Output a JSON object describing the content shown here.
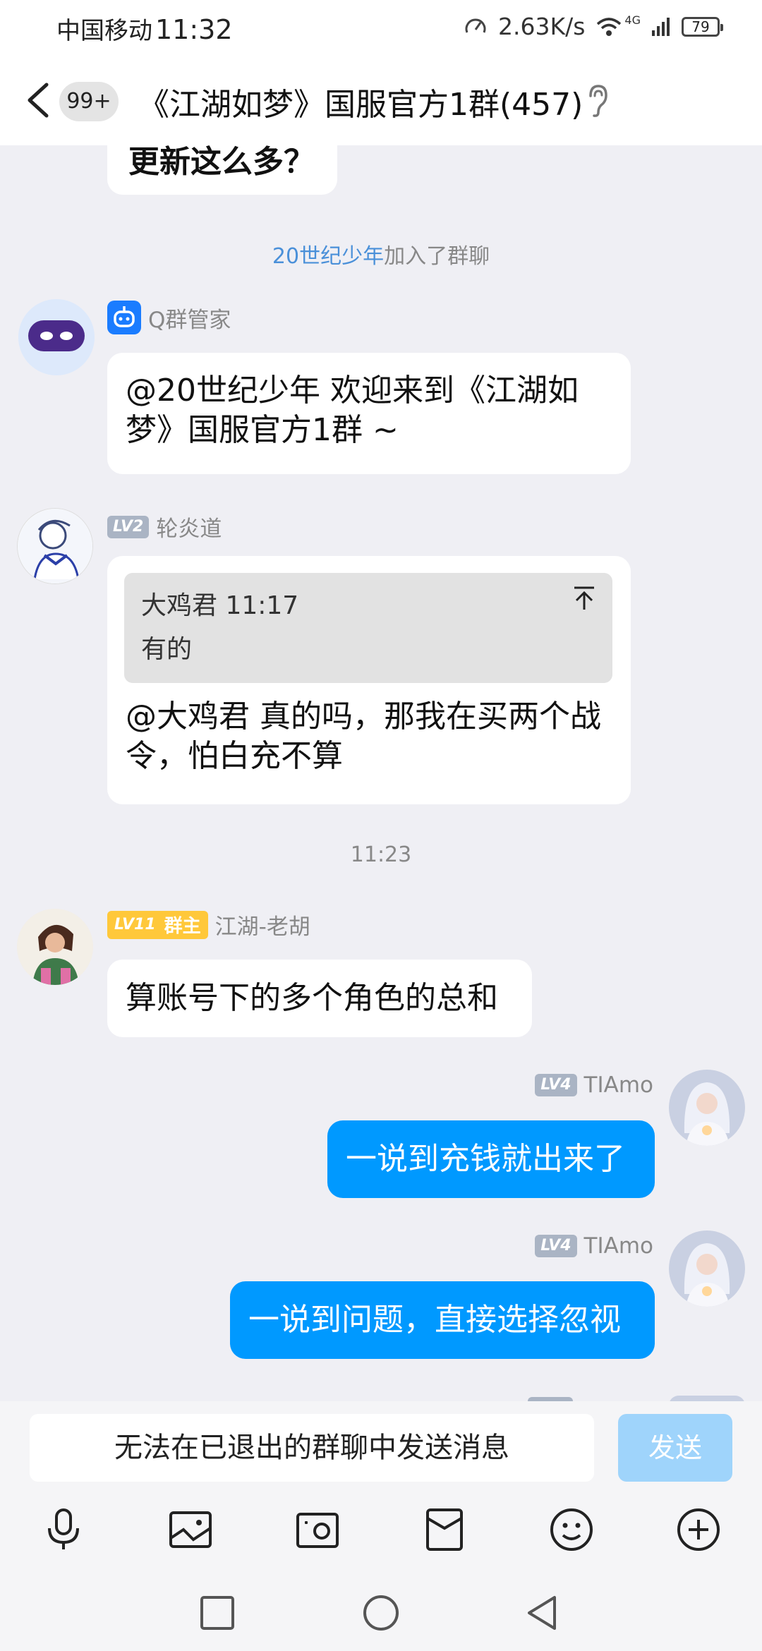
{
  "status_bar": {
    "carrier": "中国移动",
    "time": "11:32",
    "speed": "2.63K/s",
    "network": "4G",
    "battery": "79"
  },
  "header": {
    "unread_badge": "99+",
    "title": "《江湖如梦》国服官方1群(457)"
  },
  "messages": {
    "partial_text": "更新这么多？",
    "system_join": {
      "name": "20世纪少年",
      "text": "加入了群聊"
    },
    "bot": {
      "sender": "Q群管家",
      "text": "@20世纪少年 欢迎来到《江湖如梦》国服官方1群 ~"
    },
    "reply": {
      "level": "LV2",
      "sender": "轮炎道",
      "quote_author_time": "大鸡君 11:17",
      "quote_text": "有的",
      "text": "@大鸡君 真的吗，那我在买两个战令，怕白充不算"
    },
    "timestamp": "11:23",
    "owner_msg": {
      "level": "LV11",
      "role": "群主",
      "sender": "江湖-老胡",
      "text": "算账号下的多个角色的总和"
    },
    "self_msg_1": {
      "level": "LV4",
      "sender": "TIAmo",
      "text": "一说到充钱就出来了"
    },
    "self_msg_2": {
      "level": "LV4",
      "sender": "TIAmo",
      "text": "一说到问题，直接选择忽视"
    }
  },
  "input": {
    "placeholder": "无法在已退出的群聊中发送消息",
    "send_label": "发送"
  },
  "colors": {
    "self_bubble": "#0099ff",
    "link": "#4a90d9",
    "owner_badge": "#ffc83a",
    "send_disabled": "#9fd4fb"
  }
}
